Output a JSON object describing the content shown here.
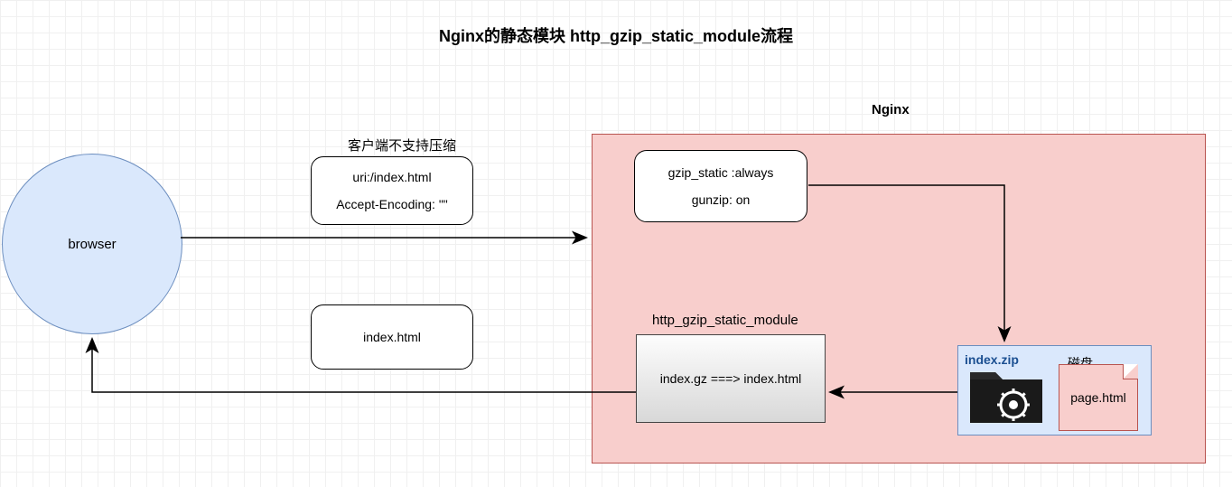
{
  "title": "Nginx的静态模块 http_gzip_static_module流程",
  "browser": {
    "label": "browser"
  },
  "nginx": {
    "label": "Nginx"
  },
  "client_note": "客户端不支持压缩",
  "request": {
    "uri": "uri:/index.html",
    "accept_encoding": "Accept-Encoding: \"\""
  },
  "response": {
    "body": "index.html"
  },
  "config": {
    "gzip_static": "gzip_static :always",
    "gunzip": "gunzip: on"
  },
  "module": {
    "name": "http_gzip_static_module",
    "transform": "index.gz ===> index.html"
  },
  "disk": {
    "label": "磁盘",
    "zip_file": "index.zip",
    "page_file": "page.html"
  }
}
